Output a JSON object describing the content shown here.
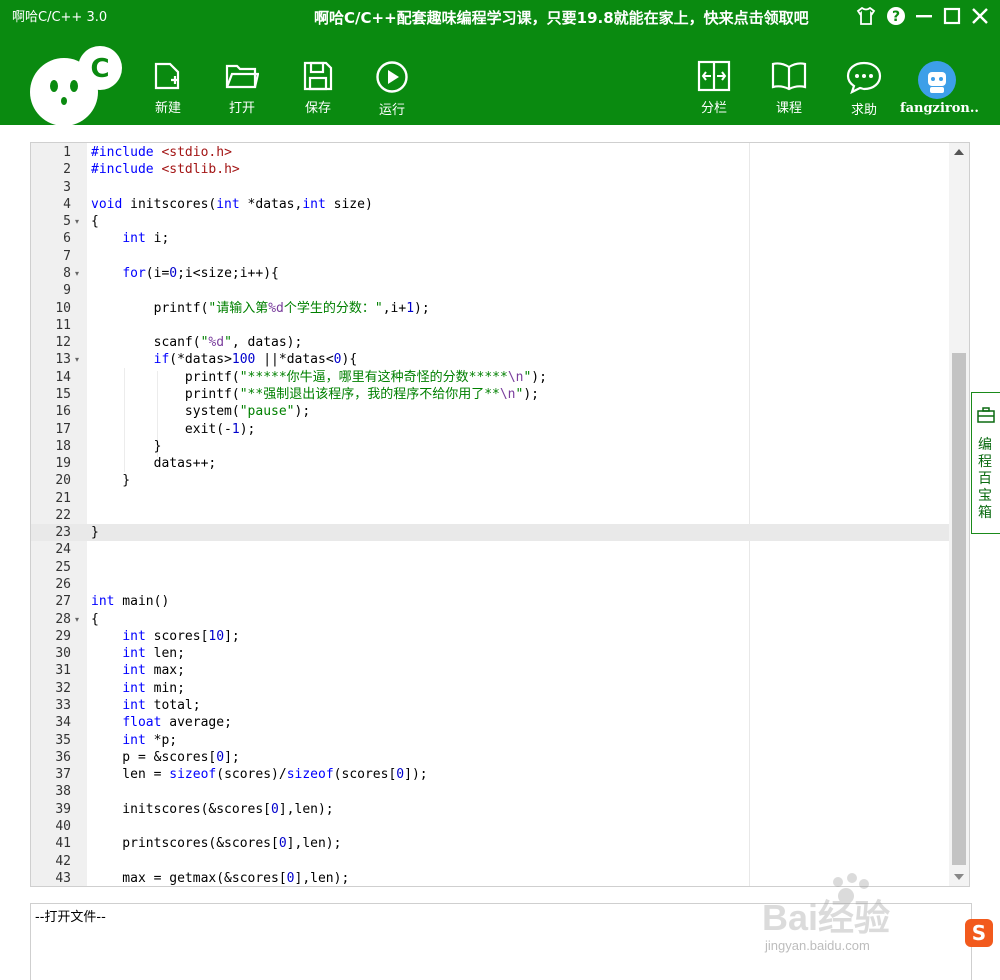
{
  "app": {
    "title": "啊哈C/C++ 3.0",
    "promo": "啊哈C/C++配套趣味编程学习课，只要19.8就能在家上，快来点击领取吧"
  },
  "window_controls": [
    {
      "name": "skin-icon"
    },
    {
      "name": "help-icon"
    },
    {
      "name": "minimize-icon"
    },
    {
      "name": "maximize-icon"
    },
    {
      "name": "close-icon"
    }
  ],
  "toolbar": {
    "new": "新建",
    "open": "打开",
    "save": "保存",
    "run": "运行",
    "split": "分栏",
    "course": "课程",
    "help": "求助",
    "user": "fangziron..."
  },
  "theme": {
    "header_bg": "#0a8a10",
    "keyword": "#0000ff",
    "string": "#008000",
    "include_file": "#a31515"
  },
  "editor": {
    "active_line": 23,
    "lines": [
      {
        "n": "1",
        "text": "#include <stdio.h>"
      },
      {
        "n": "2",
        "text": "#include <stdlib.h>"
      },
      {
        "n": "3",
        "text": ""
      },
      {
        "n": "4",
        "text": "void initscores(int *datas,int size)"
      },
      {
        "n": "5",
        "text": "{",
        "fold": true
      },
      {
        "n": "6",
        "text": "    int i;"
      },
      {
        "n": "7",
        "text": ""
      },
      {
        "n": "8",
        "text": "    for(i=0;i<size;i++){",
        "fold": true
      },
      {
        "n": "9",
        "text": ""
      },
      {
        "n": "10",
        "text": "        printf(\"请输入第%d个学生的分数：\",i+1);"
      },
      {
        "n": "11",
        "text": ""
      },
      {
        "n": "12",
        "text": "        scanf(\"%d\", datas);"
      },
      {
        "n": "13",
        "text": "        if(*datas>100 ||*datas<0){",
        "fold": true
      },
      {
        "n": "14",
        "text": "            printf(\"*****你牛逼，哪里有这种奇怪的分数*****\\n\");"
      },
      {
        "n": "15",
        "text": "            printf(\"**强制退出该程序，我的程序不给你用了**\\n\");"
      },
      {
        "n": "16",
        "text": "            system(\"pause\");"
      },
      {
        "n": "17",
        "text": "            exit(-1);"
      },
      {
        "n": "18",
        "text": "        }"
      },
      {
        "n": "19",
        "text": "        datas++;"
      },
      {
        "n": "20",
        "text": "    }"
      },
      {
        "n": "21",
        "text": ""
      },
      {
        "n": "22",
        "text": ""
      },
      {
        "n": "23",
        "text": "}"
      },
      {
        "n": "24",
        "text": ""
      },
      {
        "n": "25",
        "text": ""
      },
      {
        "n": "26",
        "text": ""
      },
      {
        "n": "27",
        "text": "int main()"
      },
      {
        "n": "28",
        "text": "{",
        "fold": true
      },
      {
        "n": "29",
        "text": "    int scores[10];"
      },
      {
        "n": "30",
        "text": "    int len;"
      },
      {
        "n": "31",
        "text": "    int max;"
      },
      {
        "n": "32",
        "text": "    int min;"
      },
      {
        "n": "33",
        "text": "    int total;"
      },
      {
        "n": "34",
        "text": "    float average;"
      },
      {
        "n": "35",
        "text": "    int *p;"
      },
      {
        "n": "36",
        "text": "    p = &scores[0];"
      },
      {
        "n": "37",
        "text": "    len = sizeof(scores)/sizeof(scores[0]);"
      },
      {
        "n": "38",
        "text": ""
      },
      {
        "n": "39",
        "text": "    initscores(&scores[0],len);"
      },
      {
        "n": "40",
        "text": ""
      },
      {
        "n": "41",
        "text": "    printscores(&scores[0],len);"
      },
      {
        "n": "42",
        "text": ""
      },
      {
        "n": "43",
        "text": "    max = getmax(&scores[0],len);"
      }
    ]
  },
  "side_panel": {
    "label": "编程百宝箱"
  },
  "output": {
    "text": "--打开文件--"
  },
  "watermark": {
    "brand": "Bai经验",
    "url": "jingyan.baidu.com"
  }
}
